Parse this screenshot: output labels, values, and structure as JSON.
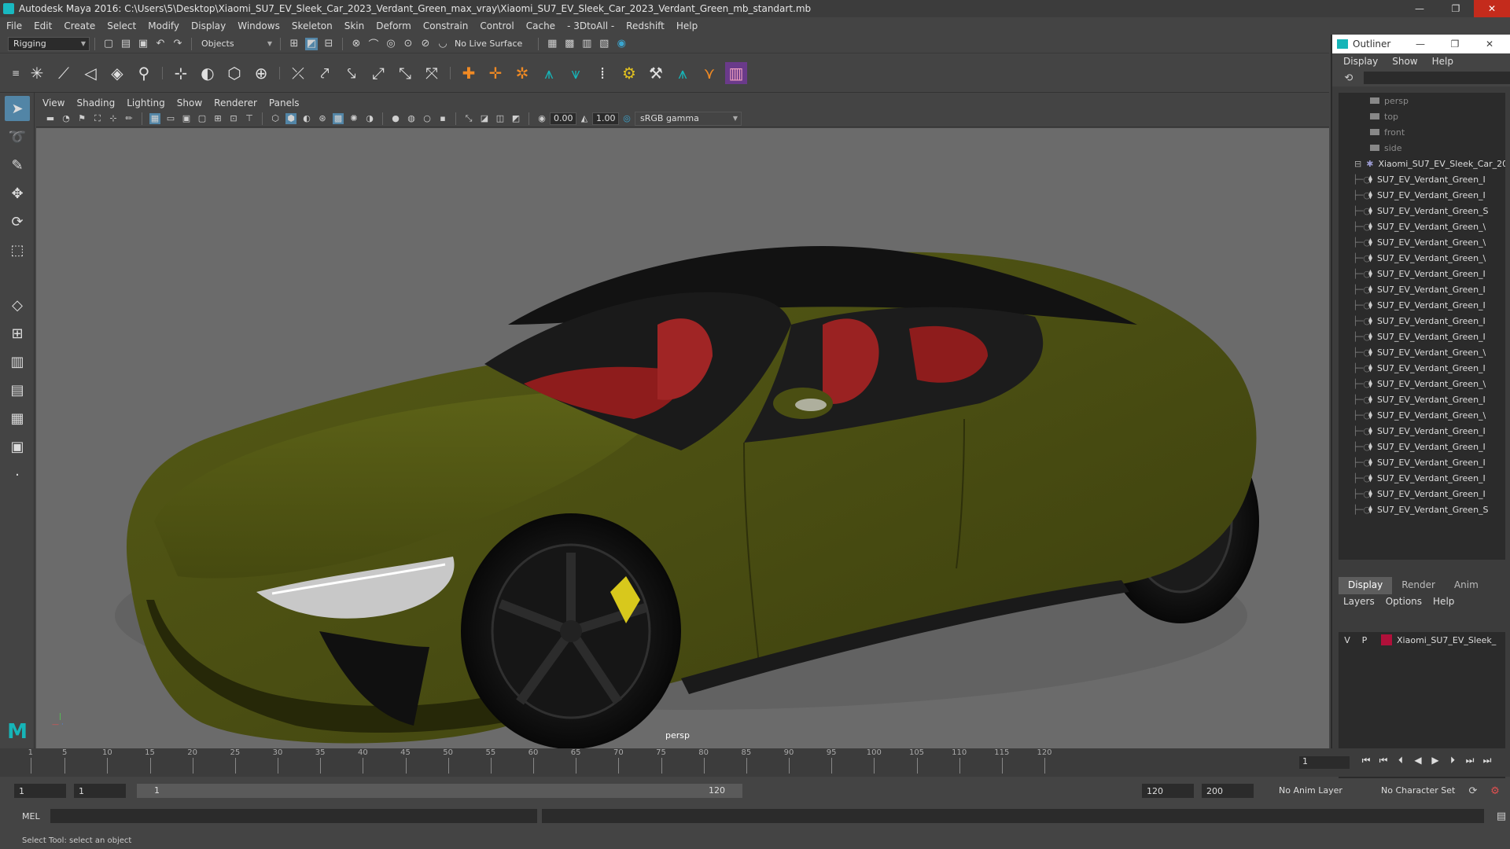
{
  "window": {
    "title": "Autodesk Maya 2016: C:\\Users\\5\\Desktop\\Xiaomi_SU7_EV_Sleek_Car_2023_Verdant_Green_max_vray\\Xiaomi_SU7_EV_Sleek_Car_2023_Verdant_Green_mb_standart.mb",
    "minimize": "—",
    "maximize": "❐",
    "close": "✕"
  },
  "menu": [
    "File",
    "Edit",
    "Create",
    "Select",
    "Modify",
    "Display",
    "Windows",
    "Skeleton",
    "Skin",
    "Deform",
    "Constrain",
    "Control",
    "Cache",
    "- 3DtoAll -",
    "Redshift",
    "Help"
  ],
  "statusline": {
    "mode": "Rigging",
    "selection_mode": "Objects",
    "live_surface": "No Live Surface"
  },
  "panel_menu": [
    "View",
    "Shading",
    "Lighting",
    "Show",
    "Renderer",
    "Panels"
  ],
  "panel_tools": {
    "exposure": "0.00",
    "gamma": "1.00",
    "color_space": "sRGB gamma"
  },
  "viewport": {
    "camera_label": "persp",
    "car_color": "#4a4e12",
    "interior_color": "#8e1c1c",
    "caliper_color": "#d8c81c",
    "background": "#6b6b6b"
  },
  "outliner": {
    "title": "Outliner",
    "menu": [
      "Display",
      "Show",
      "Help"
    ],
    "cameras": [
      "persp",
      "top",
      "front",
      "side"
    ],
    "group": "Xiaomi_SU7_EV_Sleek_Car_20",
    "children": [
      "SU7_EV_Verdant_Green_I",
      "SU7_EV_Verdant_Green_I",
      "SU7_EV_Verdant_Green_S",
      "SU7_EV_Verdant_Green_\\",
      "SU7_EV_Verdant_Green_\\",
      "SU7_EV_Verdant_Green_\\",
      "SU7_EV_Verdant_Green_I",
      "SU7_EV_Verdant_Green_I",
      "SU7_EV_Verdant_Green_I",
      "SU7_EV_Verdant_Green_I",
      "SU7_EV_Verdant_Green_I",
      "SU7_EV_Verdant_Green_\\",
      "SU7_EV_Verdant_Green_I",
      "SU7_EV_Verdant_Green_\\",
      "SU7_EV_Verdant_Green_I",
      "SU7_EV_Verdant_Green_\\",
      "SU7_EV_Verdant_Green_I",
      "SU7_EV_Verdant_Green_I",
      "SU7_EV_Verdant_Green_I",
      "SU7_EV_Verdant_Green_I",
      "SU7_EV_Verdant_Green_I",
      "SU7_EV_Verdant_Green_S"
    ]
  },
  "layers": {
    "tabs": [
      "Display",
      "Render",
      "Anim"
    ],
    "menu": [
      "Layers",
      "Options",
      "Help"
    ],
    "rows": [
      {
        "v": "V",
        "p": "P",
        "name": "Xiaomi_SU7_EV_Sleek_",
        "color": "#b0103a"
      }
    ]
  },
  "timeline": {
    "ticks": [
      "1",
      "5",
      "10",
      "15",
      "20",
      "25",
      "30",
      "35",
      "40",
      "45",
      "50",
      "55",
      "60",
      "65",
      "70",
      "75",
      "80",
      "85",
      "90",
      "95",
      "100",
      "105",
      "110",
      "115",
      "120"
    ],
    "current_frame": "1",
    "playback_icons": [
      "⏮",
      "⏮",
      "⏴",
      "◀",
      "▶",
      "⏵",
      "⏭",
      "⏭"
    ]
  },
  "range": {
    "start": "1",
    "playback_start": "1",
    "slider_start": "1",
    "slider_end": "120",
    "playback_end": "120",
    "end": "200",
    "anim_layer": "No Anim Layer",
    "character_set": "No Character Set"
  },
  "cmdline": {
    "label": "MEL"
  },
  "helpline": {
    "text": "Select Tool: select an object"
  }
}
